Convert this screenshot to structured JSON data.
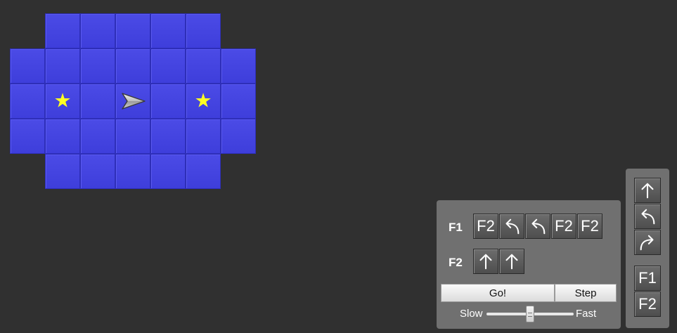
{
  "board": {
    "tiles": [
      {
        "col": 1,
        "row": 0
      },
      {
        "col": 2,
        "row": 0
      },
      {
        "col": 3,
        "row": 0
      },
      {
        "col": 4,
        "row": 0
      },
      {
        "col": 5,
        "row": 0
      },
      {
        "col": 0,
        "row": 1
      },
      {
        "col": 1,
        "row": 1
      },
      {
        "col": 2,
        "row": 1
      },
      {
        "col": 3,
        "row": 1
      },
      {
        "col": 4,
        "row": 1
      },
      {
        "col": 5,
        "row": 1
      },
      {
        "col": 6,
        "row": 1
      },
      {
        "col": 0,
        "row": 2
      },
      {
        "col": 1,
        "row": 2
      },
      {
        "col": 2,
        "row": 2
      },
      {
        "col": 3,
        "row": 2
      },
      {
        "col": 4,
        "row": 2
      },
      {
        "col": 5,
        "row": 2
      },
      {
        "col": 6,
        "row": 2
      },
      {
        "col": 0,
        "row": 3
      },
      {
        "col": 1,
        "row": 3
      },
      {
        "col": 2,
        "row": 3
      },
      {
        "col": 3,
        "row": 3
      },
      {
        "col": 4,
        "row": 3
      },
      {
        "col": 5,
        "row": 3
      },
      {
        "col": 6,
        "row": 3
      },
      {
        "col": 1,
        "row": 4
      },
      {
        "col": 2,
        "row": 4
      },
      {
        "col": 3,
        "row": 4
      },
      {
        "col": 4,
        "row": 4
      },
      {
        "col": 5,
        "row": 4
      }
    ],
    "stars": [
      {
        "col": 1,
        "row": 2
      },
      {
        "col": 5,
        "row": 2
      }
    ],
    "ship": {
      "col": 3,
      "row": 2,
      "facing": "right"
    },
    "tile_color": "#4545e0",
    "star_color": "#ffff22",
    "star_glyph": "★"
  },
  "program": {
    "f1": {
      "label": "F1",
      "slots": [
        {
          "kind": "call",
          "text": "F2"
        },
        {
          "kind": "turn-left-icon"
        },
        {
          "kind": "turn-left-icon"
        },
        {
          "kind": "call",
          "text": "F2"
        },
        {
          "kind": "call",
          "text": "F2"
        }
      ]
    },
    "f2": {
      "label": "F2",
      "slots": [
        {
          "kind": "forward-arrow-icon"
        },
        {
          "kind": "forward-arrow-icon"
        }
      ]
    },
    "go_label": "Go!",
    "step_label": "Step",
    "speed": {
      "slow_label": "Slow",
      "fast_label": "Fast",
      "value": 0.5
    }
  },
  "palette": {
    "moves": [
      "forward-arrow-icon",
      "turn-left-icon",
      "turn-right-icon"
    ],
    "functions": [
      "F1",
      "F2"
    ]
  }
}
